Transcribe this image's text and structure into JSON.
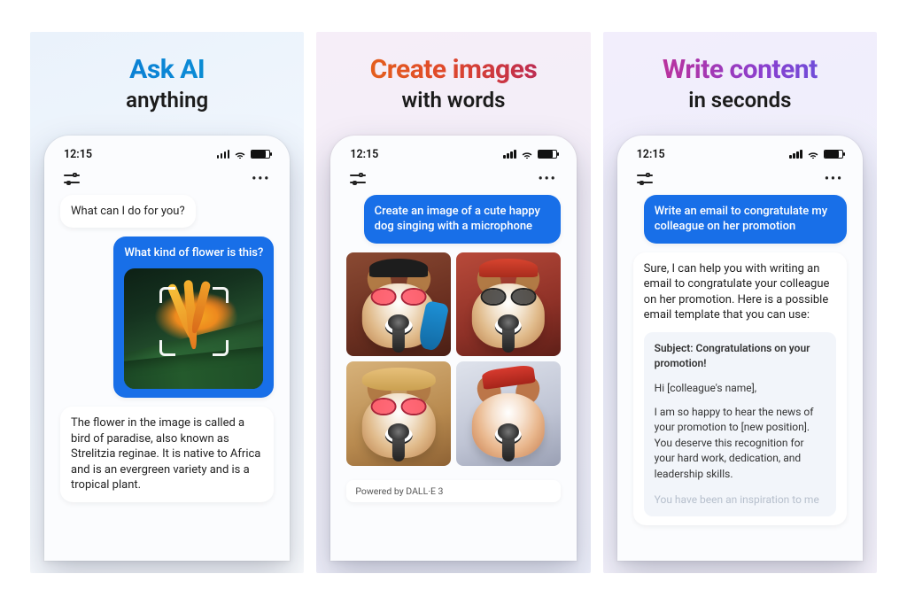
{
  "status": {
    "time": "12:15"
  },
  "panels": [
    {
      "titleA": "Ask AI",
      "titleB": "anything",
      "botGreeting": "What can I do for you?",
      "userMsg": "What kind of flower is this?",
      "botAnswer": "The flower in the image is called a bird of paradise, also known as Strelitzia reginae. It is native to Africa and is an evergreen variety and is a tropical plant."
    },
    {
      "titleA": "Create images",
      "titleB": "with words",
      "userMsg": "Create an image of a cute happy dog singing with a microphone",
      "powered": "Powered by DALL·E 3"
    },
    {
      "titleA": "Write content",
      "titleB": "in seconds",
      "userMsg": "Write an email to congratulate my colleague on her promotion",
      "botIntro": "Sure, I can help you with writing an email to congratulate your colleague on her promotion. Here is a possible email template that you can use:",
      "email": {
        "subject": "Subject: Congratulations on your promotion!",
        "greeting": "Hi [colleague's name],",
        "body": "I am so happy to hear the news of your promotion to [new position]. You deserve this recognition for your hard work, dedication, and leadership skills.",
        "faded": "You have been an inspiration to me"
      }
    }
  ]
}
